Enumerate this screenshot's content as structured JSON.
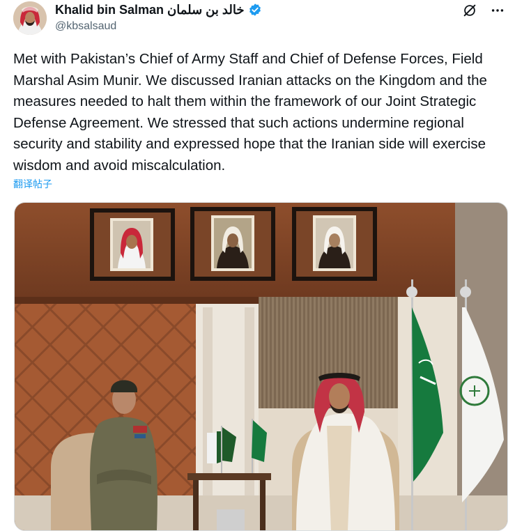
{
  "author": {
    "display_name": "Khalid bin Salman خالد بن سلمان",
    "handle": "@kbsalsaud",
    "verified": true
  },
  "icons": {
    "grok": "grok-icon",
    "more": "more-icon",
    "verified": "verified-badge-icon"
  },
  "tweet": {
    "text": "Met with Pakistan’s Chief of Army Staff and Chief of Defense Forces, Field Marshal Asim Munir. We discussed Iranian attacks on the Kingdom and the measures needed to halt them within the framework of our Joint Strategic Defense Agreement. We stressed that such actions undermine regional security and stability and expressed hope that the Iranian side will exercise wisdom and avoid miscalculation.",
    "translate_label": "翻译帖子"
  },
  "colors": {
    "link_blue": "#1d9bf0",
    "secondary_text": "#536471",
    "verified_blue": "#1d9bf0",
    "saudi_green": "#167a3e"
  }
}
